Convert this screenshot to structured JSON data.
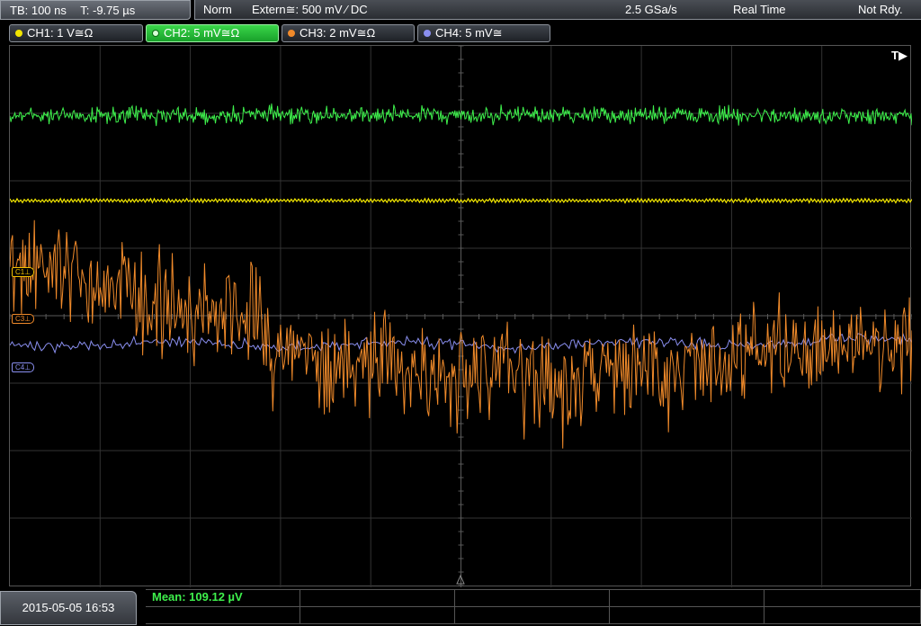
{
  "header": {
    "timebase": "TB: 100 ns",
    "trigger_time": "T: -9.75 µs",
    "mode": "Norm",
    "trigger_source": "Extern≅: 500 mV ⁄ DC",
    "sample_rate": "2.5 GSa/s",
    "acq_mode": "Real Time",
    "state": "Not Rdy."
  },
  "channels": [
    {
      "label": "CH1: 1 V≅Ω",
      "color": "#f2e600"
    },
    {
      "label": "CH2: 5 mV≅Ω",
      "color": "#3ef04c"
    },
    {
      "label": "CH3: 2 mV≅Ω",
      "color": "#f08a2a"
    },
    {
      "label": "CH4: 5 mV≅",
      "color": "#8a8ff0"
    }
  ],
  "markers": {
    "ch1": "C1⊥",
    "ch3": "C3⊥",
    "ch4": "C4⊥",
    "trigger": "T▶"
  },
  "footer": {
    "datetime": "2015-05-05 16:53",
    "measurement": "Mean: 109.12 µV"
  }
}
